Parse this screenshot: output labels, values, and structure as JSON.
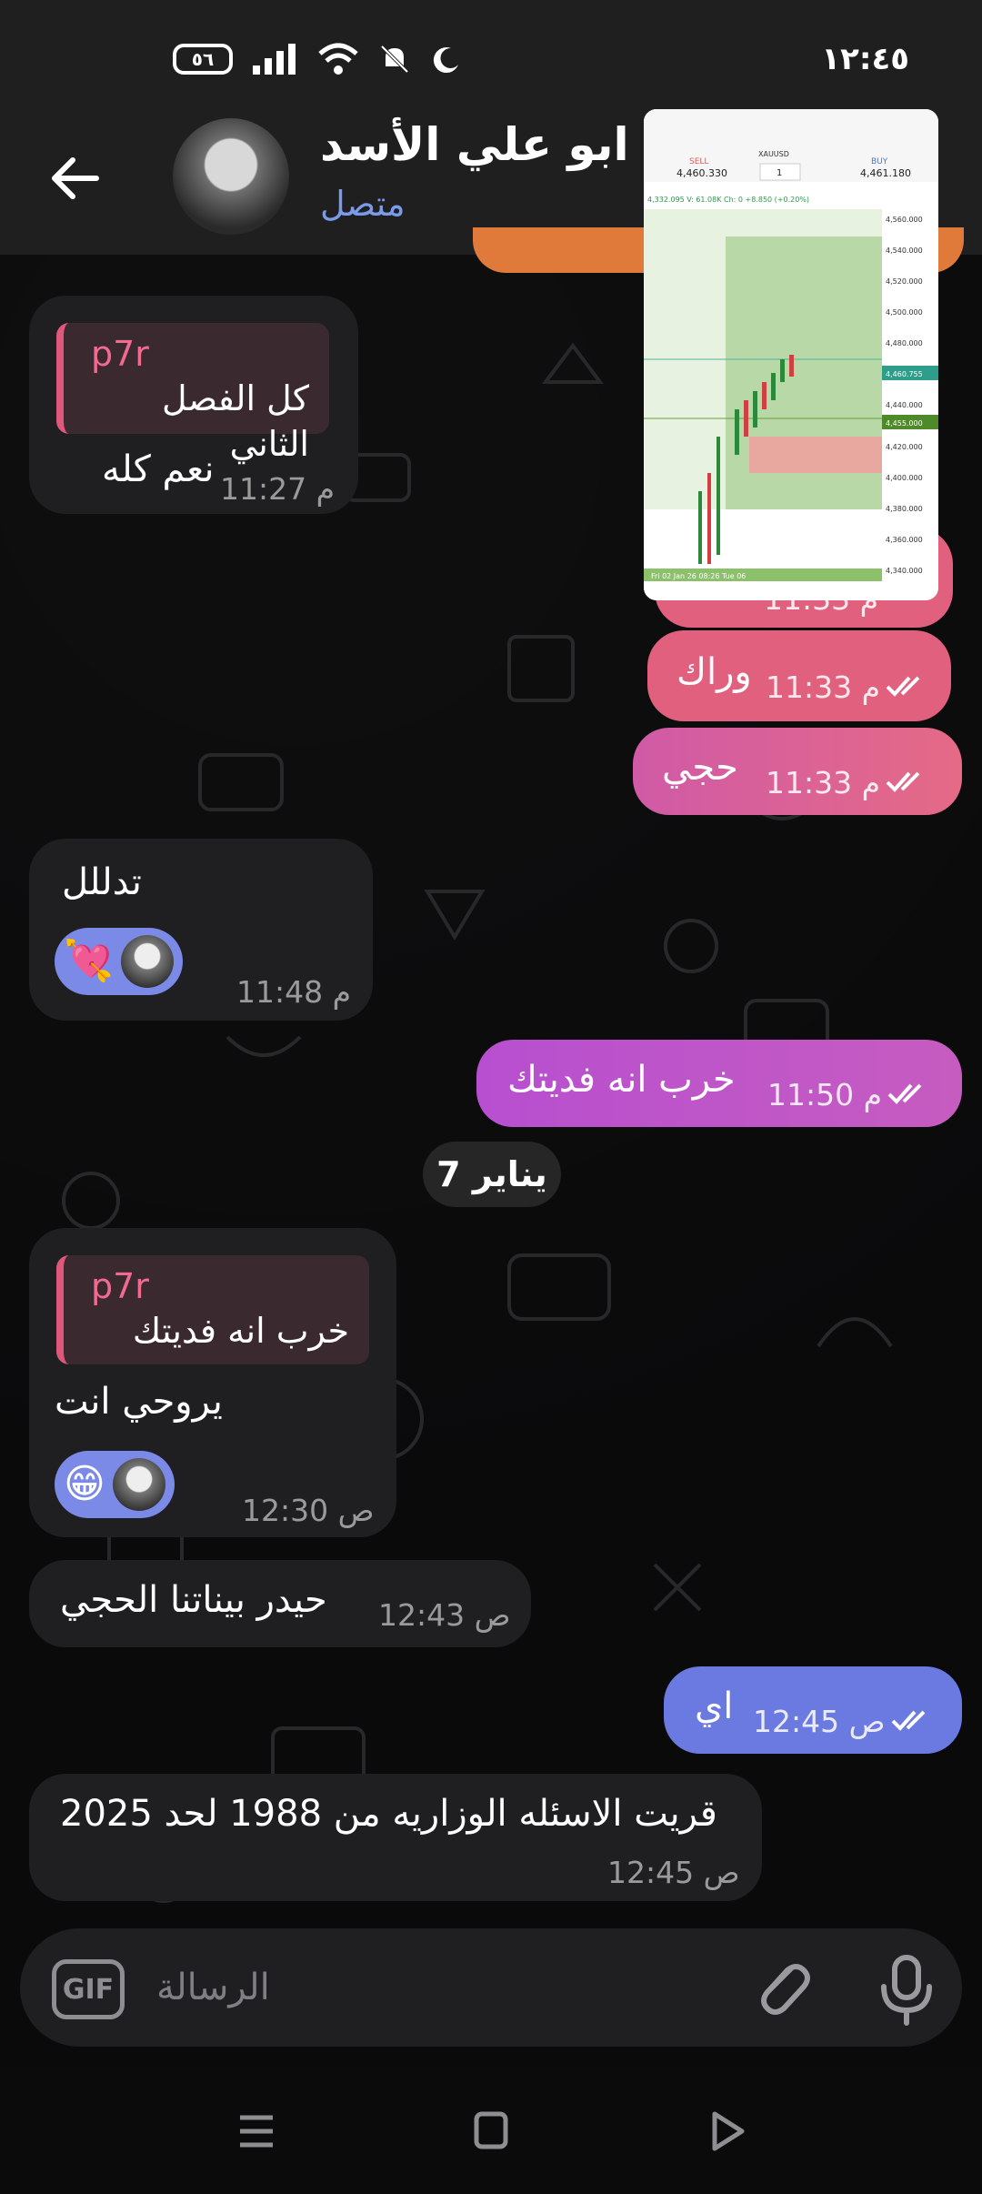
{
  "status_bar": {
    "time": "١٢:٤٥",
    "battery": "٥٦"
  },
  "header": {
    "contact_name": "ابو علي الأسد",
    "contact_status": "متصل"
  },
  "colors": {
    "bubble_orange": "#e07a3a",
    "bubble_pink": "#e0607e",
    "bubble_magenta": "#b74fd0",
    "bubble_purple": "#7a7ae6",
    "reply_accent": "#e0577c",
    "status_online": "#7b9be8"
  },
  "messages": [
    {
      "dir": "in",
      "reply_to": {
        "name": "p7r",
        "text": "كل الفصل الثاني"
      },
      "text": "نعم كله",
      "time": "11:27 م"
    },
    {
      "dir": "out",
      "type": "image",
      "time": "11:33 م"
    },
    {
      "dir": "out",
      "text": "وراك",
      "time": "11:33 م"
    },
    {
      "dir": "out",
      "text": "حجي",
      "time": "11:33 م"
    },
    {
      "dir": "in",
      "text": "تدللل",
      "reaction": "💘",
      "time": "11:48 م"
    },
    {
      "dir": "out",
      "text": "خرب انه فديتك",
      "time": "11:50 م"
    },
    {
      "dir": "in",
      "reply_to": {
        "name": "p7r",
        "text": "خرب انه فديتك"
      },
      "text": "يروحي انت",
      "reaction": "😁",
      "time": "12:30 ص"
    },
    {
      "dir": "in",
      "text": "حيدر بيناتنا الحجي",
      "time": "12:43 ص"
    },
    {
      "dir": "out",
      "text": "اي",
      "time": "12:45 ص"
    },
    {
      "dir": "in",
      "text": "قريت الاسئله الوزاريه من 1988 لحد 2025",
      "time": "12:45 ص"
    }
  ],
  "date_separator": "7 يناير",
  "chart_image": {
    "symbol": "XAUUSD",
    "sell_label": "SELL",
    "sell_price": "4,460.330",
    "buy_label": "BUY",
    "buy_price": "4,461.180",
    "lot": "1",
    "info": "4,332.095  V: 61.08K  Ch: 0  +8.850  (+0.20%)",
    "price_ticks": [
      "4,560.000",
      "4,540.000",
      "4,520.000",
      "4,500.000",
      "4,480.000",
      "4,460.755",
      "4,440.000",
      "4,455.000",
      "4,420.000",
      "4,400.000",
      "4,380.000",
      "4,360.000",
      "4,340.000"
    ],
    "footer": "Fri 02 Jan 26 08:26  Tue 06"
  },
  "composer": {
    "placeholder": "الرسالة",
    "gif_label": "GIF"
  }
}
